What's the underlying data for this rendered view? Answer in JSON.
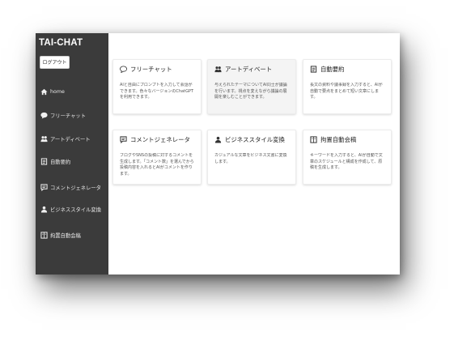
{
  "app": {
    "brand": "TAI-CHAT",
    "logout_label": "ログアウト"
  },
  "sidebar": {
    "items": [
      {
        "label": "home",
        "icon": "home-icon"
      },
      {
        "label": "フリーチャット",
        "icon": "chat-bubble-icon"
      },
      {
        "label": "アートディベート",
        "icon": "users-icon"
      },
      {
        "label": "自動要約",
        "icon": "document-icon"
      },
      {
        "label": "コメントジェネレータ",
        "icon": "comment-icon"
      },
      {
        "label": "ビジネススタイル変換",
        "icon": "person-icon"
      },
      {
        "label": "拘置自動会稿",
        "icon": "book-icon"
      }
    ]
  },
  "cards": [
    {
      "title": "フリーチャット",
      "icon": "chat-bubble-icon",
      "desc": "AIと自由にプロンプトを入力して会話ができます。色々なバージョンのChatGPTを利用できます。"
    },
    {
      "title": "アートディベート",
      "icon": "users-icon",
      "desc": "与えられたテーマについてAI同士が議論を行います。視点を変えながら議論の展開を楽しむことができます。"
    },
    {
      "title": "自動要約",
      "icon": "document-icon",
      "desc": "長文の資料や議事録を入力すると、AIが自動で要点をまとめて短い文章にします。"
    },
    {
      "title": "コメントジェネレータ",
      "icon": "comment-icon",
      "desc": "ブログやSNSの投稿に対するコメントを生成します。「コメント数」を選んでから投稿内容を入れるとAIがコメントを作ります。"
    },
    {
      "title": "ビジネススタイル変換",
      "icon": "person-icon",
      "desc": "カジュアルな文章をビジネス文書に変換します。"
    },
    {
      "title": "拘置自動会稿",
      "icon": "book-icon",
      "desc": "キーワードを入力すると、AIが自動で文章のスケジュールと構成を作成して、原稿を生成します。"
    }
  ],
  "colors": {
    "sidebar_bg": "#3b3b3b",
    "main_bg": "#ffffff",
    "card_hover_bg": "#f4f4f4"
  }
}
